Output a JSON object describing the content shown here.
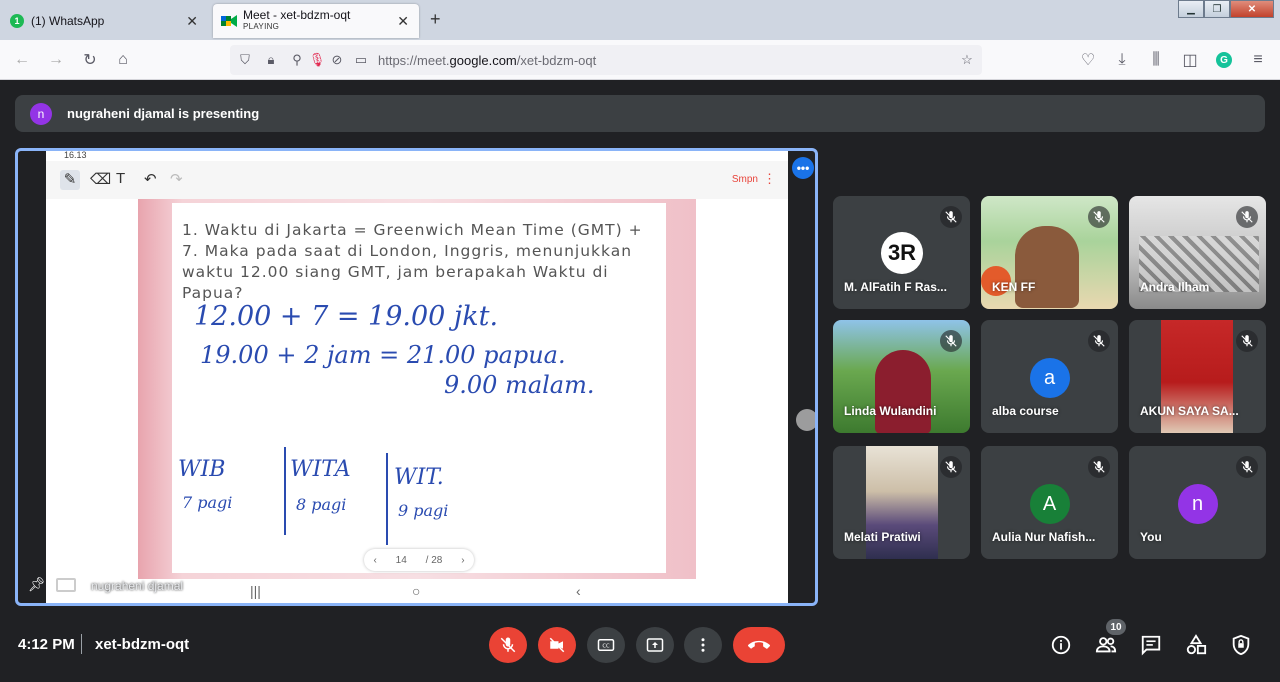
{
  "browser": {
    "tabs": [
      {
        "title": "(1) WhatsApp",
        "badge": "1"
      },
      {
        "title": "Meet - xet-bdzm-oqt",
        "subtitle": "PLAYING"
      }
    ],
    "url_prefix": "https://meet.",
    "url_domain": "google.com",
    "url_path": "/xet-bdzm-oqt"
  },
  "meet": {
    "presenter_initial": "n",
    "presenting_text": "nugraheni djamal is presenting",
    "stage": {
      "status_time": "16.13",
      "app_label": "Smpn",
      "question": "1. Waktu di Jakarta = Greenwich Mean Time (GMT) + 7. Maka pada saat di London, Inggris, menunjukkan waktu 12.00 siang GMT, jam berapakah Waktu di Papua?",
      "handwriting": {
        "line1": "12.00 + 7 = 19.00 jkt.",
        "line2": "19.00 + 2 jam = 21.00 papua.",
        "line3": "9.00 malam.",
        "col1_title": "WIB",
        "col1_sub": "7 pagi",
        "col2_title": "WITA",
        "col2_sub": "8 pagi",
        "col3_title": "WIT.",
        "col3_sub": "9 pagi"
      },
      "page_current": "14",
      "page_total": "/ 28",
      "presenter_name": "nugraheni djamal"
    },
    "participants": [
      {
        "name": "M. AlFatih F Ras...",
        "type": "logo"
      },
      {
        "name": "KEN FF",
        "type": "video"
      },
      {
        "name": "Andra Ilham",
        "type": "video"
      },
      {
        "name": "Linda Wulandini",
        "type": "video"
      },
      {
        "name": "alba course",
        "type": "avatar",
        "initial": "a",
        "color": "#1a73e8"
      },
      {
        "name": "AKUN SAYA SA...",
        "type": "video"
      },
      {
        "name": "Melati Pratiwi",
        "type": "video"
      },
      {
        "name": "Aulia Nur Nafish...",
        "type": "avatar",
        "initial": "A",
        "color": "#188038"
      },
      {
        "name": "You",
        "type": "avatar",
        "initial": "n",
        "color": "#9334e6"
      }
    ],
    "bottom": {
      "time": "4:12 PM",
      "meeting_code": "xet-bdzm-oqt",
      "participant_count": "10"
    }
  }
}
